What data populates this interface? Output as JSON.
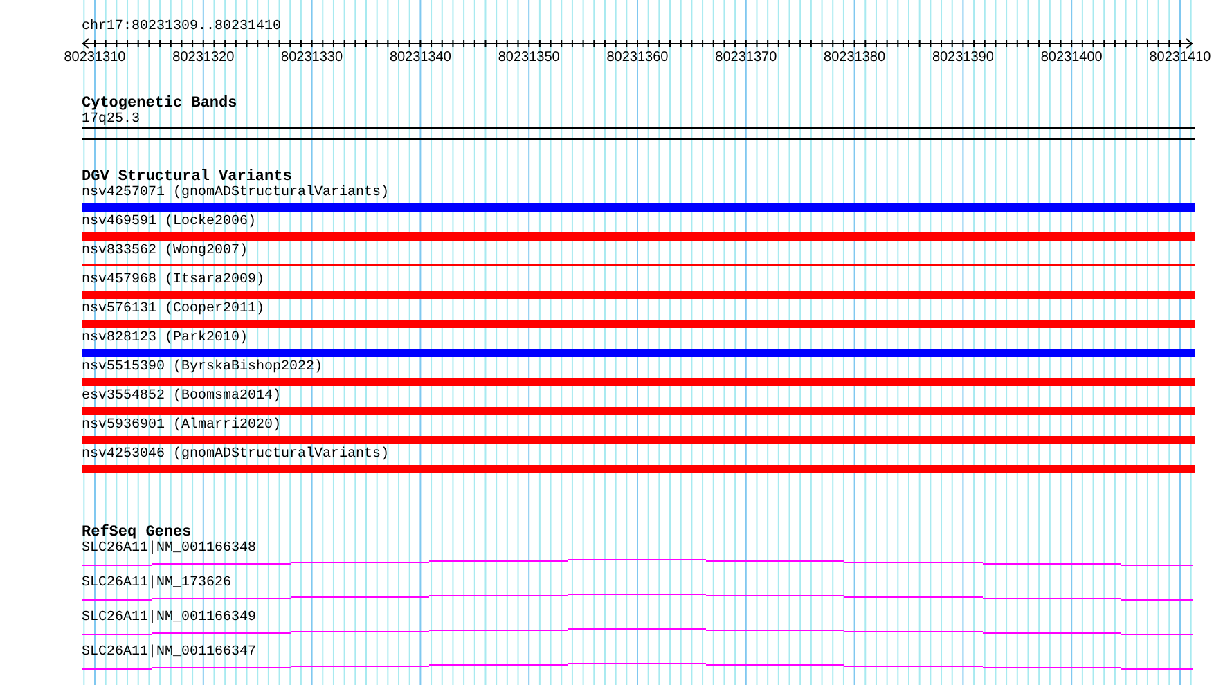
{
  "ruler": {
    "position": "chr17:80231309..80231410",
    "tick_labels": [
      "80231310",
      "80231320",
      "80231330",
      "80231340",
      "80231350",
      "80231360",
      "80231370",
      "80231380",
      "80231390",
      "80231400",
      "80231410"
    ]
  },
  "cytogenetic_bands": {
    "title": "Cytogenetic Bands",
    "band": "17q25.3"
  },
  "dgv_structural_variants": {
    "title": "DGV Structural Variants",
    "items": [
      {
        "label": "nsv4257071 (gnomADStructuralVariants)",
        "color": "#0000ff",
        "kind": "bar"
      },
      {
        "label": "nsv469591 (Locke2006)",
        "color": "#ff0000",
        "kind": "bar"
      },
      {
        "label": "nsv833562 (Wong2007)",
        "color": "#ff0000",
        "kind": "line"
      },
      {
        "label": "nsv457968 (Itsara2009)",
        "color": "#ff0000",
        "kind": "bar"
      },
      {
        "label": "nsv576131 (Cooper2011)",
        "color": "#ff0000",
        "kind": "bar"
      },
      {
        "label": "nsv828123 (Park2010)",
        "color": "#0000ff",
        "kind": "bar"
      },
      {
        "label": "nsv5515390 (ByrskaBishop2022)",
        "color": "#ff0000",
        "kind": "bar"
      },
      {
        "label": "esv3554852 (Boomsma2014)",
        "color": "#ff0000",
        "kind": "bar"
      },
      {
        "label": "nsv5936901 (Almarri2020)",
        "color": "#ff0000",
        "kind": "bar"
      },
      {
        "label": "nsv4253046 (gnomADStructuralVariants)",
        "color": "#ff0000",
        "kind": "bar"
      }
    ]
  },
  "refseq_genes": {
    "title": "RefSeq Genes",
    "items": [
      {
        "label": "SLC26A11|NM_001166348"
      },
      {
        "label": "SLC26A11|NM_173626"
      },
      {
        "label": "SLC26A11|NM_001166349"
      },
      {
        "label": "SLC26A11|NM_001166347"
      }
    ]
  }
}
